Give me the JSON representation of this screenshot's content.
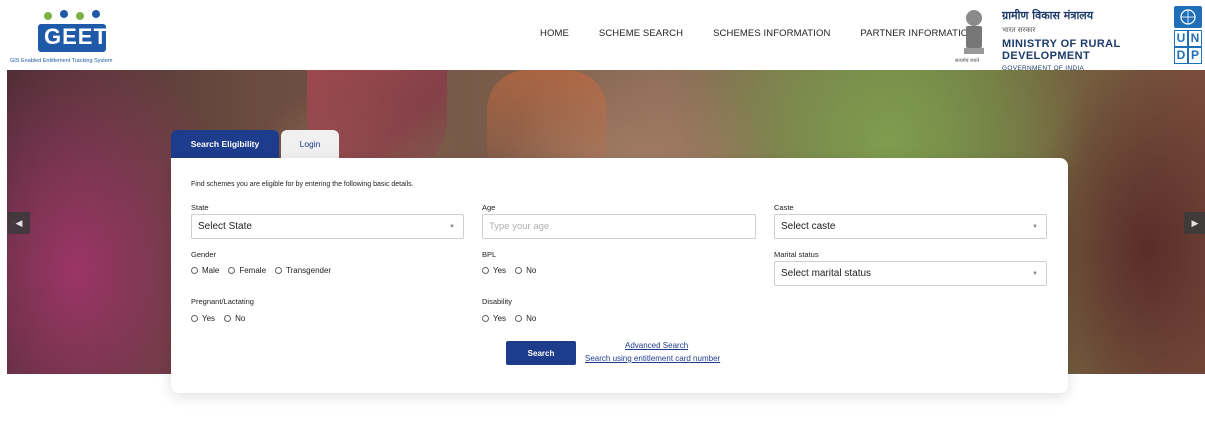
{
  "header": {
    "logo_text": "GEET",
    "logo_tagline": "GIS Enabled Entitlement Tracking System",
    "nav": [
      "HOME",
      "SCHEME SEARCH",
      "SCHEMES INFORMATION",
      "PARTNER INFORMATION"
    ],
    "emblem_caption": "सत्यमेव जयते",
    "ministry_hindi": "ग्रामीण विकास मंत्रालय",
    "govt_hindi": "भारत सरकार",
    "ministry_english": "MINISTRY OF RURAL DEVELOPMENT",
    "govt_english": "GOVERNMENT OF INDIA",
    "undp_letters": [
      "U",
      "N",
      "D",
      "P"
    ]
  },
  "colors": {
    "primary": "#1e3c8c",
    "ministry_text": "#1d3b6a",
    "undp_blue": "#1f6fb6"
  },
  "tabs": {
    "active": "Search Eligibility",
    "inactive": "Login"
  },
  "form": {
    "intro": "Find schemes you are eligible for by entering the following basic details.",
    "state_label": "State",
    "state_value": "Select State",
    "age_label": "Age",
    "age_placeholder": "Type your age",
    "caste_label": "Caste",
    "caste_value": "Select caste",
    "gender_label": "Gender",
    "gender_options": [
      "Male",
      "Female",
      "Transgender"
    ],
    "bpl_label": "BPL",
    "bpl_options": [
      "Yes",
      "No"
    ],
    "marital_label": "Marital status",
    "marital_value": "Select marital status",
    "pregnant_label": "Pregnant/Lactating",
    "pregnant_options": [
      "Yes",
      "No"
    ],
    "disability_label": "Disability",
    "disability_options": [
      "Yes",
      "No"
    ],
    "search_button": "Search",
    "advanced_link": "Advanced Search",
    "card_link": "Search using entitlement card number"
  },
  "icons": {
    "carousel_prev": "◀",
    "carousel_next": "▶",
    "dropdown": "▼"
  }
}
